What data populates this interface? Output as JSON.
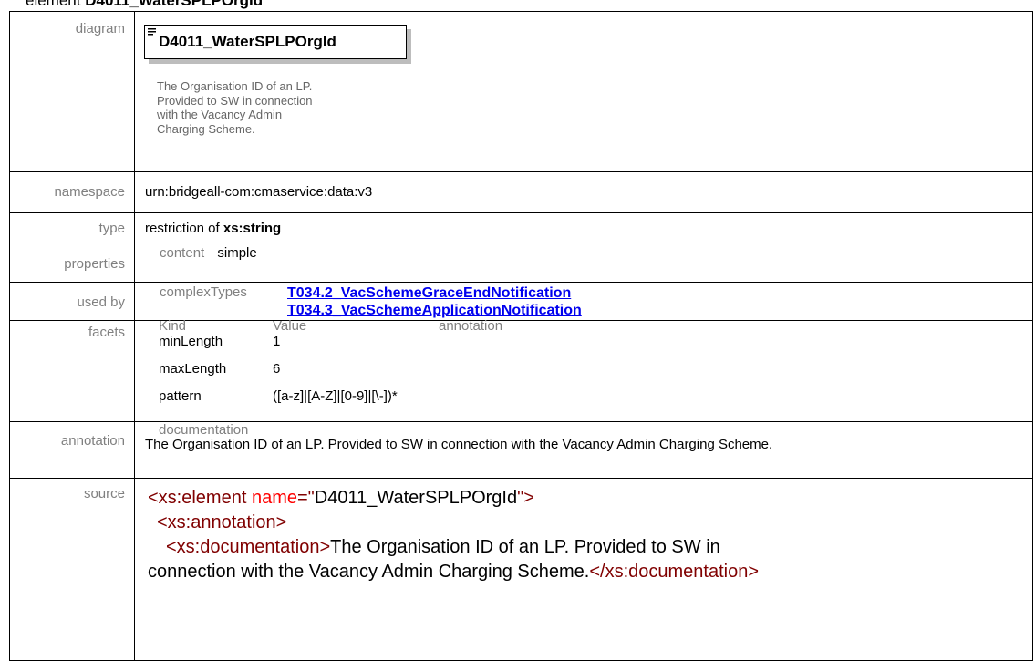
{
  "header": {
    "prefix": "element",
    "name": "D4011_WaterSPLPOrgId"
  },
  "diagram": {
    "label": "diagram",
    "element_name": "D4011_WaterSPLPOrgId",
    "doc_lines": [
      "The Organisation ID of an LP.",
      "Provided to SW in connection",
      "with the Vacancy Admin",
      "Charging Scheme."
    ]
  },
  "namespace": {
    "label": "namespace",
    "value": "urn:bridgeall-com:cmaservice:data:v3"
  },
  "type": {
    "label": "type",
    "prefix": "restriction of",
    "value": "xs:string"
  },
  "properties": {
    "label": "properties",
    "key": "content",
    "value": "simple"
  },
  "used_by": {
    "label": "used by",
    "key": "complexTypes",
    "links": [
      "T034.2_VacSchemeGraceEndNotification",
      "T034.3_VacSchemeApplicationNotification"
    ]
  },
  "facets": {
    "label": "facets",
    "headers": [
      "Kind",
      "Value",
      "annotation"
    ],
    "rows": [
      {
        "kind": "minLength",
        "value": "1"
      },
      {
        "kind": "maxLength",
        "value": "6"
      },
      {
        "kind": "pattern",
        "value": "([a-z]|[A-Z]|[0-9]|[\\-])*"
      }
    ]
  },
  "annotation": {
    "label": "annotation",
    "key": "documentation",
    "text": "The Organisation ID of an LP. Provided to SW in connection with the Vacancy Admin Charging Scheme."
  },
  "source": {
    "label": "source",
    "l1_open": "<xs:element",
    "l1_attr": "name",
    "l1_eq": "=\"",
    "l1_val": "D4011_WaterSPLPOrgId",
    "l1_close": "\">",
    "l2": "<xs:annotation>",
    "l3_open": "<xs:documentation>",
    "l3_text": "The Organisation ID of an LP. Provided to SW in",
    "l4_text": "connection with the Vacancy Admin Charging Scheme.",
    "l4_close": "</xs:documentation>"
  }
}
